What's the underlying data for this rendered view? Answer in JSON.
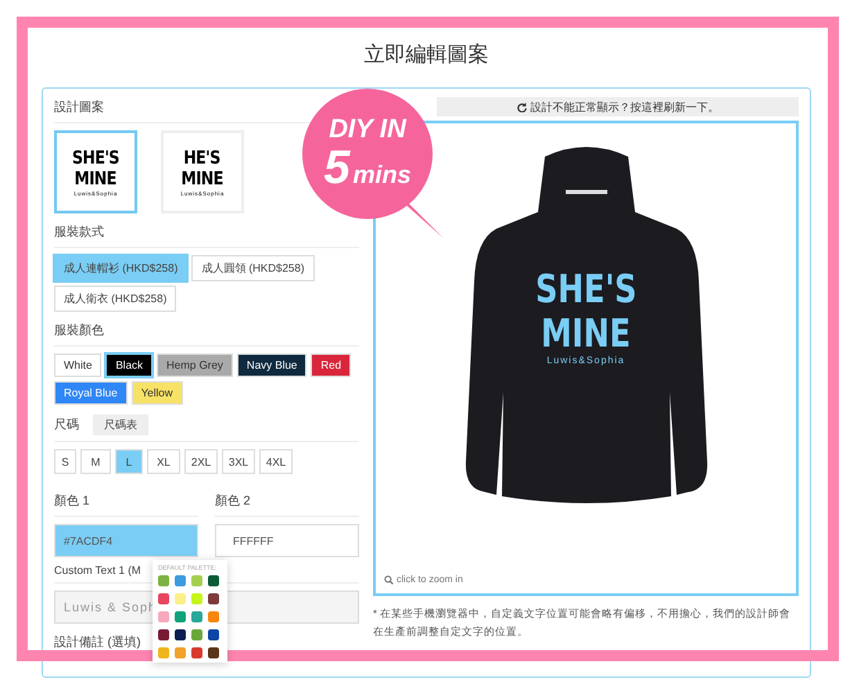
{
  "title": "立即編輯圖案",
  "badge": {
    "line1": "DIY IN",
    "number": "5",
    "unit": "mins"
  },
  "design": {
    "label": "設計圖案",
    "items": [
      {
        "line1": "SHE'S",
        "line2": "MINE",
        "brand": "Luwis&Sophia",
        "selected": true
      },
      {
        "line1": "HE'S",
        "line2": "MINE",
        "brand": "Luwis&Sophia",
        "selected": false
      }
    ]
  },
  "styles": {
    "label": "服裝款式",
    "items": [
      {
        "label": "成人連帽衫 (HKD$258)",
        "selected": true
      },
      {
        "label": "成人圓領 (HKD$258)",
        "selected": false
      },
      {
        "label": "成人衛衣 (HKD$258)",
        "selected": false
      }
    ]
  },
  "colors": {
    "label": "服裝顏色",
    "items": [
      {
        "label": "White",
        "color": "#ffffff",
        "selected": false
      },
      {
        "label": "Black",
        "color": "#000000",
        "selected": true
      },
      {
        "label": "Hemp Grey",
        "color": "#a9a9a9",
        "selected": false
      },
      {
        "label": "Navy Blue",
        "color": "#0f2a3f",
        "selected": false
      },
      {
        "label": "Red",
        "color": "#d9263a",
        "selected": false
      },
      {
        "label": "Royal Blue",
        "color": "#2f86f6",
        "selected": false
      },
      {
        "label": "Yellow",
        "color": "#f8e266",
        "selected": false
      }
    ]
  },
  "sizes": {
    "label": "尺碼",
    "chart_button": "尺碼表",
    "items": [
      {
        "label": "S",
        "selected": false
      },
      {
        "label": "M",
        "selected": false
      },
      {
        "label": "L",
        "selected": true
      },
      {
        "label": "XL",
        "selected": false
      },
      {
        "label": "2XL",
        "selected": false
      },
      {
        "label": "3XL",
        "selected": false
      },
      {
        "label": "4XL",
        "selected": false
      }
    ]
  },
  "color1": {
    "label": "顏色 1",
    "value": "#7ACDF4",
    "color": "#7acdf4"
  },
  "color2": {
    "label": "顏色 2",
    "value": "FFFFFF",
    "color": "#ffffff"
  },
  "custom_text": {
    "label": "Custom Text 1 (M",
    "value": "Luwis & Soph"
  },
  "notes_label": "設計備註 (選填)",
  "palette": {
    "title": "DEFAULT PALETTE:",
    "swatches": [
      {
        "color": "#7cb342"
      },
      {
        "color": "#3d9be0"
      },
      {
        "color": "#a5cf4f"
      },
      {
        "color": "#0b5b36"
      },
      {
        "color": "#e8455e"
      },
      {
        "color": "#fbf08a"
      },
      {
        "color": "#c6f51a"
      },
      {
        "color": "#7d3a3a"
      },
      {
        "color": "#f7a9bd"
      },
      {
        "color": "#0fa37c"
      },
      {
        "color": "#28a89a"
      },
      {
        "color": "#f7860e"
      },
      {
        "color": "#7a1b35"
      },
      {
        "color": "#0e1d4f"
      },
      {
        "color": "#6aa83a"
      },
      {
        "color": "#0e46a3"
      },
      {
        "color": "#f0b51a"
      },
      {
        "color": "#f2a12b"
      },
      {
        "color": "#d93a2e"
      },
      {
        "color": "#5a3518"
      }
    ]
  },
  "preview": {
    "notice": "設計不能正常顯示？按這裡刷新一下。",
    "print_line1": "SHE'S",
    "print_line2": "MINE",
    "print_brand": "Luwis&Sophia",
    "zoom_hint": "click to zoom in",
    "footnote": "* 在某些手機瀏覽器中，自定義文字位置可能會略有偏移，不用擔心，我們的設計師會在生產前調整自定文字的位置。"
  }
}
